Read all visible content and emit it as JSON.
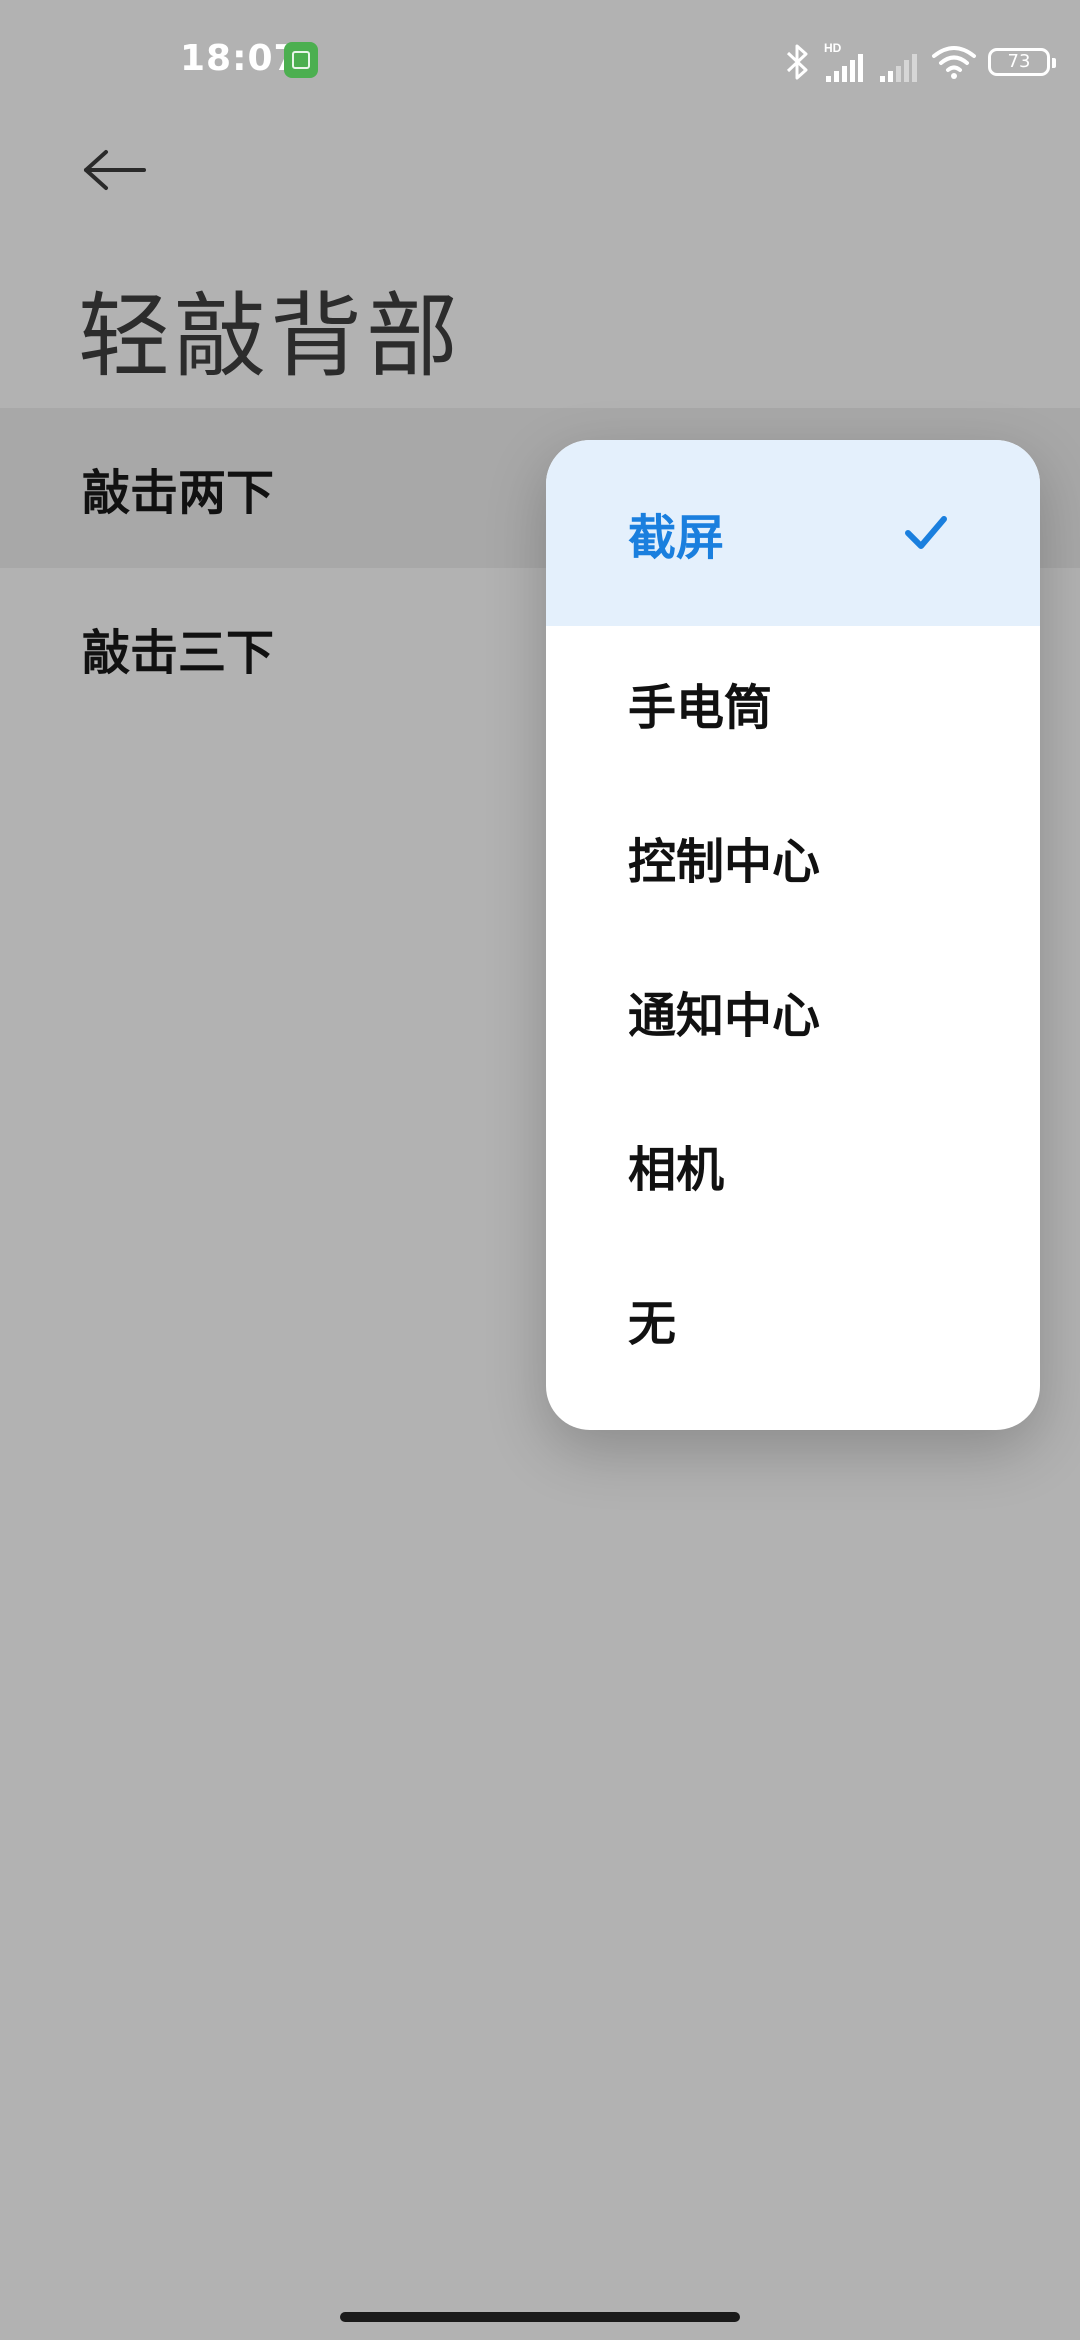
{
  "status_bar": {
    "time": "18:07",
    "network_label": "HD",
    "battery": "73",
    "icons": [
      "app-notification-icon",
      "bluetooth-icon",
      "signal-hd-icon",
      "signal-icon",
      "wifi-icon",
      "battery-icon"
    ]
  },
  "header": {
    "title": "轻敲背部"
  },
  "list": {
    "items": [
      {
        "label": "敲击两下"
      },
      {
        "label": "敲击三下"
      }
    ]
  },
  "menu": {
    "selected": "截屏",
    "options": [
      "截屏",
      "手电筒",
      "控制中心",
      "通知中心",
      "相机",
      "无"
    ],
    "accent_color": "#1a7fde",
    "selected_bg": "#e4f0fc"
  }
}
